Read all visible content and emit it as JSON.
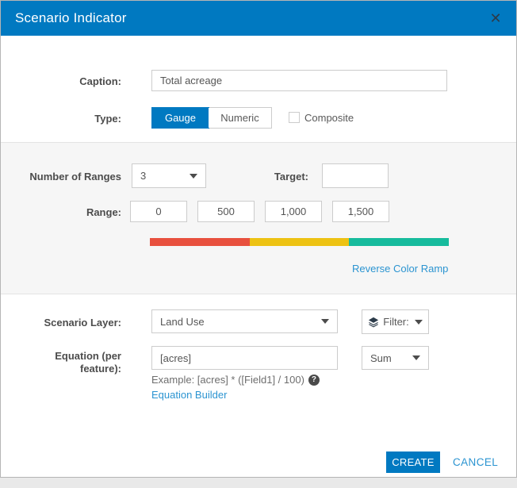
{
  "dialog": {
    "title": "Scenario Indicator",
    "close_glyph": "✕"
  },
  "form": {
    "caption": {
      "label": "Caption:",
      "value": "Total acreage"
    },
    "type": {
      "label": "Type:",
      "option_gauge": "Gauge",
      "option_numeric": "Numeric",
      "selected": "Gauge",
      "composite_label": "Composite",
      "composite_checked": false
    },
    "ranges": {
      "number_label": "Number of Ranges",
      "number_value": "3",
      "target_label": "Target:",
      "target_value": "",
      "range_label": "Range:",
      "values": [
        "0",
        "500",
        "1,000",
        "1,500"
      ],
      "ramp_colors": [
        "#e8503e",
        "#edc213",
        "#17bb9d"
      ],
      "reverse_link": "Reverse Color Ramp"
    },
    "layer": {
      "label": "Scenario Layer:",
      "value": "Land Use",
      "filter_label": "Filter:"
    },
    "equation": {
      "label_line1": "Equation (per",
      "label_line2": "feature):",
      "value": "[acres]",
      "aggregation_value": "Sum",
      "example": "Example: [acres] * ([Field1] / 100)",
      "help_glyph": "?",
      "builder_link": "Equation Builder"
    }
  },
  "footer": {
    "create_label": "CREATE",
    "cancel_label": "CANCEL"
  },
  "colors": {
    "header_blue": "#0079c1",
    "link_blue": "#2b94d1",
    "ramp_red": "#e8503e",
    "ramp_yellow": "#edc213",
    "ramp_green": "#17bb9d"
  }
}
